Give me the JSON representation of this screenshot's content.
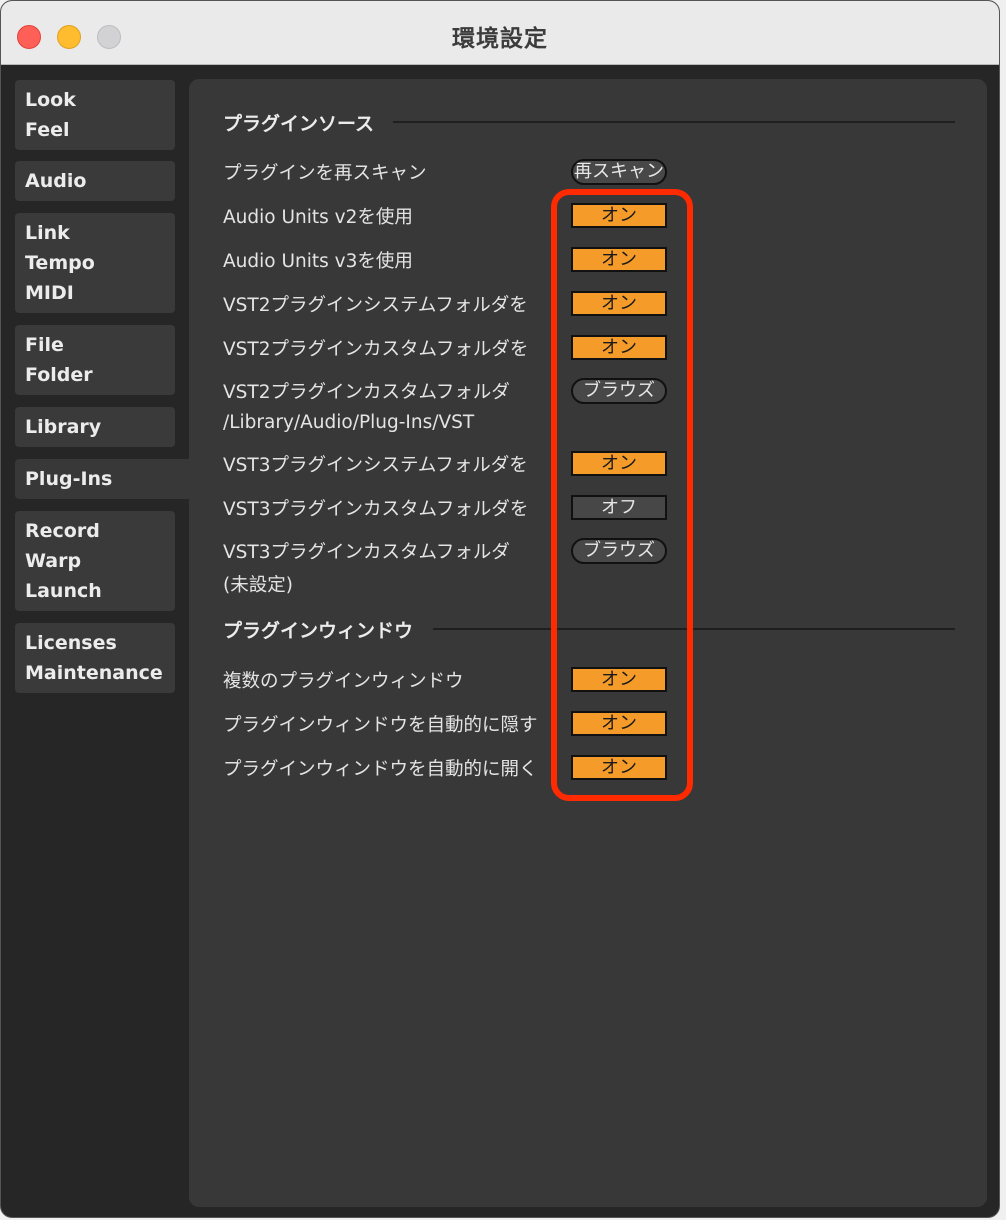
{
  "window": {
    "title": "環境設定"
  },
  "sidebar": {
    "groups": [
      {
        "items": [
          "Look",
          "Feel"
        ]
      },
      {
        "items": [
          "Audio"
        ]
      },
      {
        "items": [
          "Link",
          "Tempo",
          "MIDI"
        ]
      },
      {
        "items": [
          "File",
          "Folder"
        ]
      },
      {
        "items": [
          "Library"
        ]
      },
      {
        "items": [
          "Plug-Ins"
        ],
        "active": true
      },
      {
        "items": [
          "Record",
          "Warp",
          "Launch"
        ]
      },
      {
        "items": [
          "Licenses",
          "Maintenance"
        ]
      }
    ]
  },
  "plugin_sources": {
    "header": "プラグインソース",
    "rescan_label": "プラグインを再スキャン",
    "rescan_button": "再スキャン",
    "au_v2_label": "Audio Units v2を使用",
    "au_v2_value": "オン",
    "au_v3_label": "Audio Units v3を使用",
    "au_v3_value": "オン",
    "vst2_system_label": "VST2プラグインシステムフォルダを",
    "vst2_system_value": "オン",
    "vst2_custom_label": "VST2プラグインカスタムフォルダを",
    "vst2_custom_value": "オン",
    "vst2_folder_label": "VST2プラグインカスタムフォルダ",
    "vst2_folder_path": "/Library/Audio/Plug-Ins/VST",
    "vst2_browse_button": "ブラウズ",
    "vst3_system_label": "VST3プラグインシステムフォルダを",
    "vst3_system_value": "オン",
    "vst3_custom_label": "VST3プラグインカスタムフォルダを",
    "vst3_custom_value": "オフ",
    "vst3_folder_label": "VST3プラグインカスタムフォルダ",
    "vst3_folder_path": "(未設定)",
    "vst3_browse_button": "ブラウズ"
  },
  "plugin_windows": {
    "header": "プラグインウィンドウ",
    "multiple_label": "複数のプラグインウィンドウ",
    "multiple_value": "オン",
    "auto_hide_label": "プラグインウィンドウを自動的に隠す",
    "auto_hide_value": "オン",
    "auto_open_label": "プラグインウィンドウを自動的に開く",
    "auto_open_value": "オン"
  },
  "colors": {
    "toggle_on": "#f59b2a",
    "highlight": "#ff2a00"
  }
}
